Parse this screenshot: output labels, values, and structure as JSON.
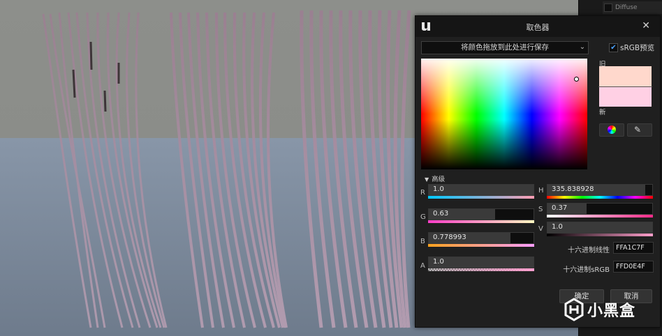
{
  "dialog": {
    "title": "取色器",
    "close_glyph": "✕",
    "drop_zone": "将颜色拖放到此处进行保存",
    "srgb_label": "sRGB预览",
    "srgb_checked": true,
    "old_label": "旧",
    "new_label": "新",
    "advanced_label": "高级",
    "old_color": "#ffd8cc",
    "new_color": "#ffd0e4",
    "channels": {
      "R": {
        "label": "R",
        "value": "1.0",
        "fill": 1.0
      },
      "G": {
        "label": "G",
        "value": "0.63",
        "fill": 0.63
      },
      "B": {
        "label": "B",
        "value": "0.778993",
        "fill": 0.778993
      },
      "A": {
        "label": "A",
        "value": "1.0",
        "fill": 1.0
      },
      "H": {
        "label": "H",
        "value": "335.838928",
        "fill": 0.9329
      },
      "S": {
        "label": "S",
        "value": "0.37",
        "fill": 0.37
      },
      "V": {
        "label": "V",
        "value": "1.0",
        "fill": 1.0
      }
    },
    "hex_linear_label": "十六进制线性",
    "hex_linear_value": "FFA1C7F",
    "hex_srgb_label": "十六进制sRGB",
    "hex_srgb_value": "FFD0E4F",
    "ok_label": "确定",
    "cancel_label": "取消"
  },
  "details": {
    "diffuse_label": "Diffuse"
  },
  "watermark": {
    "text": "小黑盒"
  },
  "icons": [
    "unreal-logo-icon",
    "close-icon",
    "chevron-down-icon",
    "check-icon",
    "color-wheel-icon",
    "eyedropper-icon",
    "triangle-down-icon",
    "xiaoheihe-logo-icon"
  ]
}
